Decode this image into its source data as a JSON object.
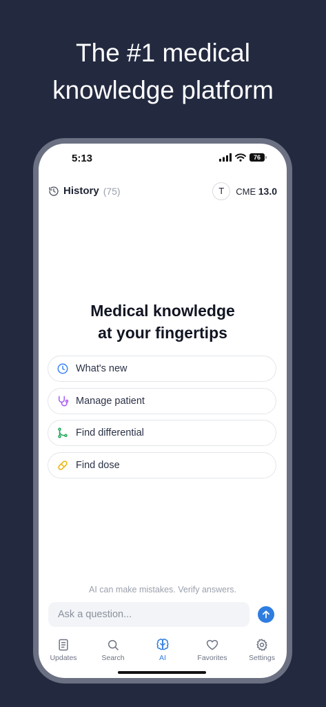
{
  "headline": {
    "line1": "The #1 medical",
    "line2": "knowledge platform"
  },
  "status_bar": {
    "time": "5:13",
    "battery": "76"
  },
  "top_bar": {
    "history_label": "History",
    "history_count": "(75)",
    "avatar_initial": "T",
    "cme_label": "CME",
    "cme_value": "13.0"
  },
  "hero": {
    "line1": "Medical knowledge",
    "line2": "at your fingertips"
  },
  "suggestions": [
    {
      "label": "What's new",
      "icon": "clock-icon",
      "color": "#3b82f6"
    },
    {
      "label": "Manage patient",
      "icon": "stethoscope-icon",
      "color": "#a855f7"
    },
    {
      "label": "Find differential",
      "icon": "branch-icon",
      "color": "#22a55a"
    },
    {
      "label": "Find dose",
      "icon": "pill-icon",
      "color": "#eab308"
    }
  ],
  "disclaimer": "AI can make mistakes. Verify answers.",
  "ask": {
    "placeholder": "Ask a question..."
  },
  "tabs": [
    {
      "label": "Updates",
      "icon": "document-icon"
    },
    {
      "label": "Search",
      "icon": "search-icon"
    },
    {
      "label": "AI",
      "icon": "brain-icon",
      "active": true
    },
    {
      "label": "Favorites",
      "icon": "heart-icon"
    },
    {
      "label": "Settings",
      "icon": "gear-icon"
    }
  ],
  "colors": {
    "background": "#232a40",
    "accent": "#2f7de1",
    "text_dark": "#1e2333",
    "muted": "#9aa0ac"
  }
}
